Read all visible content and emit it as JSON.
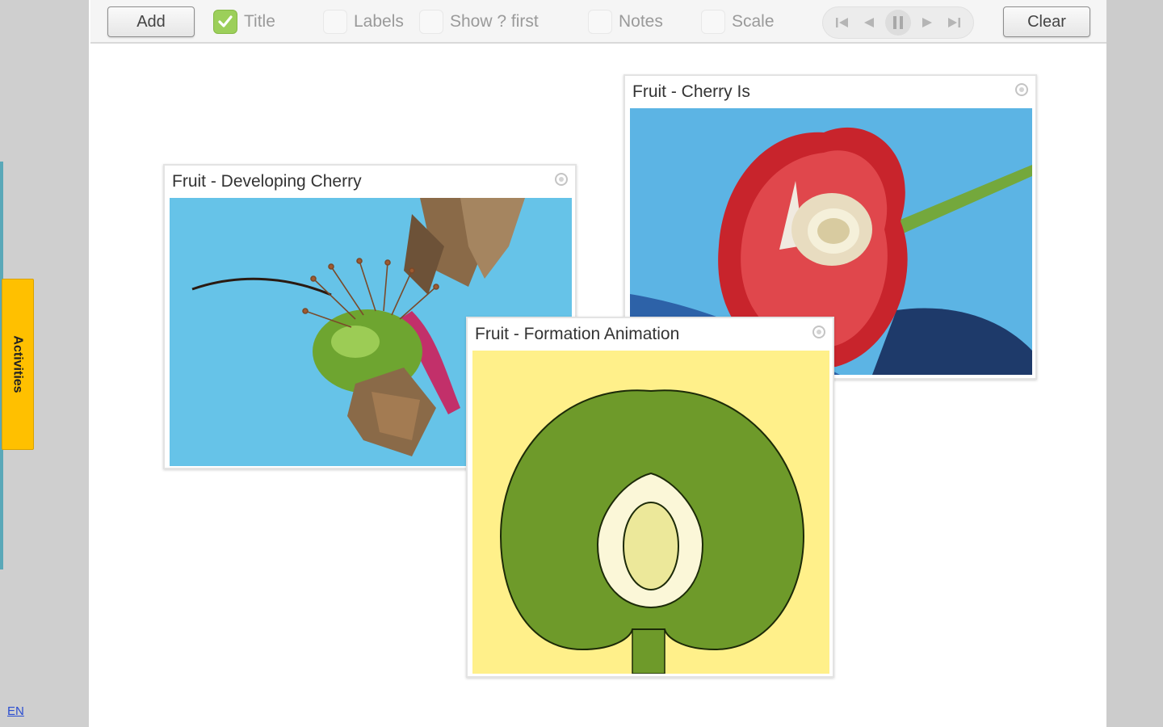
{
  "language": "EN",
  "sidebar": {
    "activities_label": "Activities"
  },
  "toolbar": {
    "add_label": "Add",
    "clear_label": "Clear",
    "options": [
      {
        "label": "Title",
        "checked": true
      },
      {
        "label": "Labels",
        "checked": false
      },
      {
        "label": "Show ? first",
        "checked": false
      },
      {
        "label": "Notes",
        "checked": false
      },
      {
        "label": "Scale",
        "checked": false
      }
    ],
    "player": [
      "skip-to-start-icon",
      "step-back-icon",
      "pause-icon",
      "step-forward-icon",
      "skip-to-end-icon"
    ]
  },
  "cards": [
    {
      "title": "Fruit - Developing Cherry",
      "media": "photo of a developing green cherry with dried petals on a blue background"
    },
    {
      "title": "Fruit - Cherry Is",
      "media": "photo of a halved red cherry showing the stone, on a blue background"
    },
    {
      "title": "Fruit - Formation Animation",
      "media": "animation of a green fruit cross-section with a pale seed in the centre"
    }
  ],
  "colors": {
    "accent_check": "#9ccf5a",
    "activities_tab": "#ffc000",
    "photo_background": "#66c3e8",
    "cherry_red": "#c8242c",
    "animation_background": "#fff08a",
    "animation_fruit": "#6e9a2a"
  }
}
